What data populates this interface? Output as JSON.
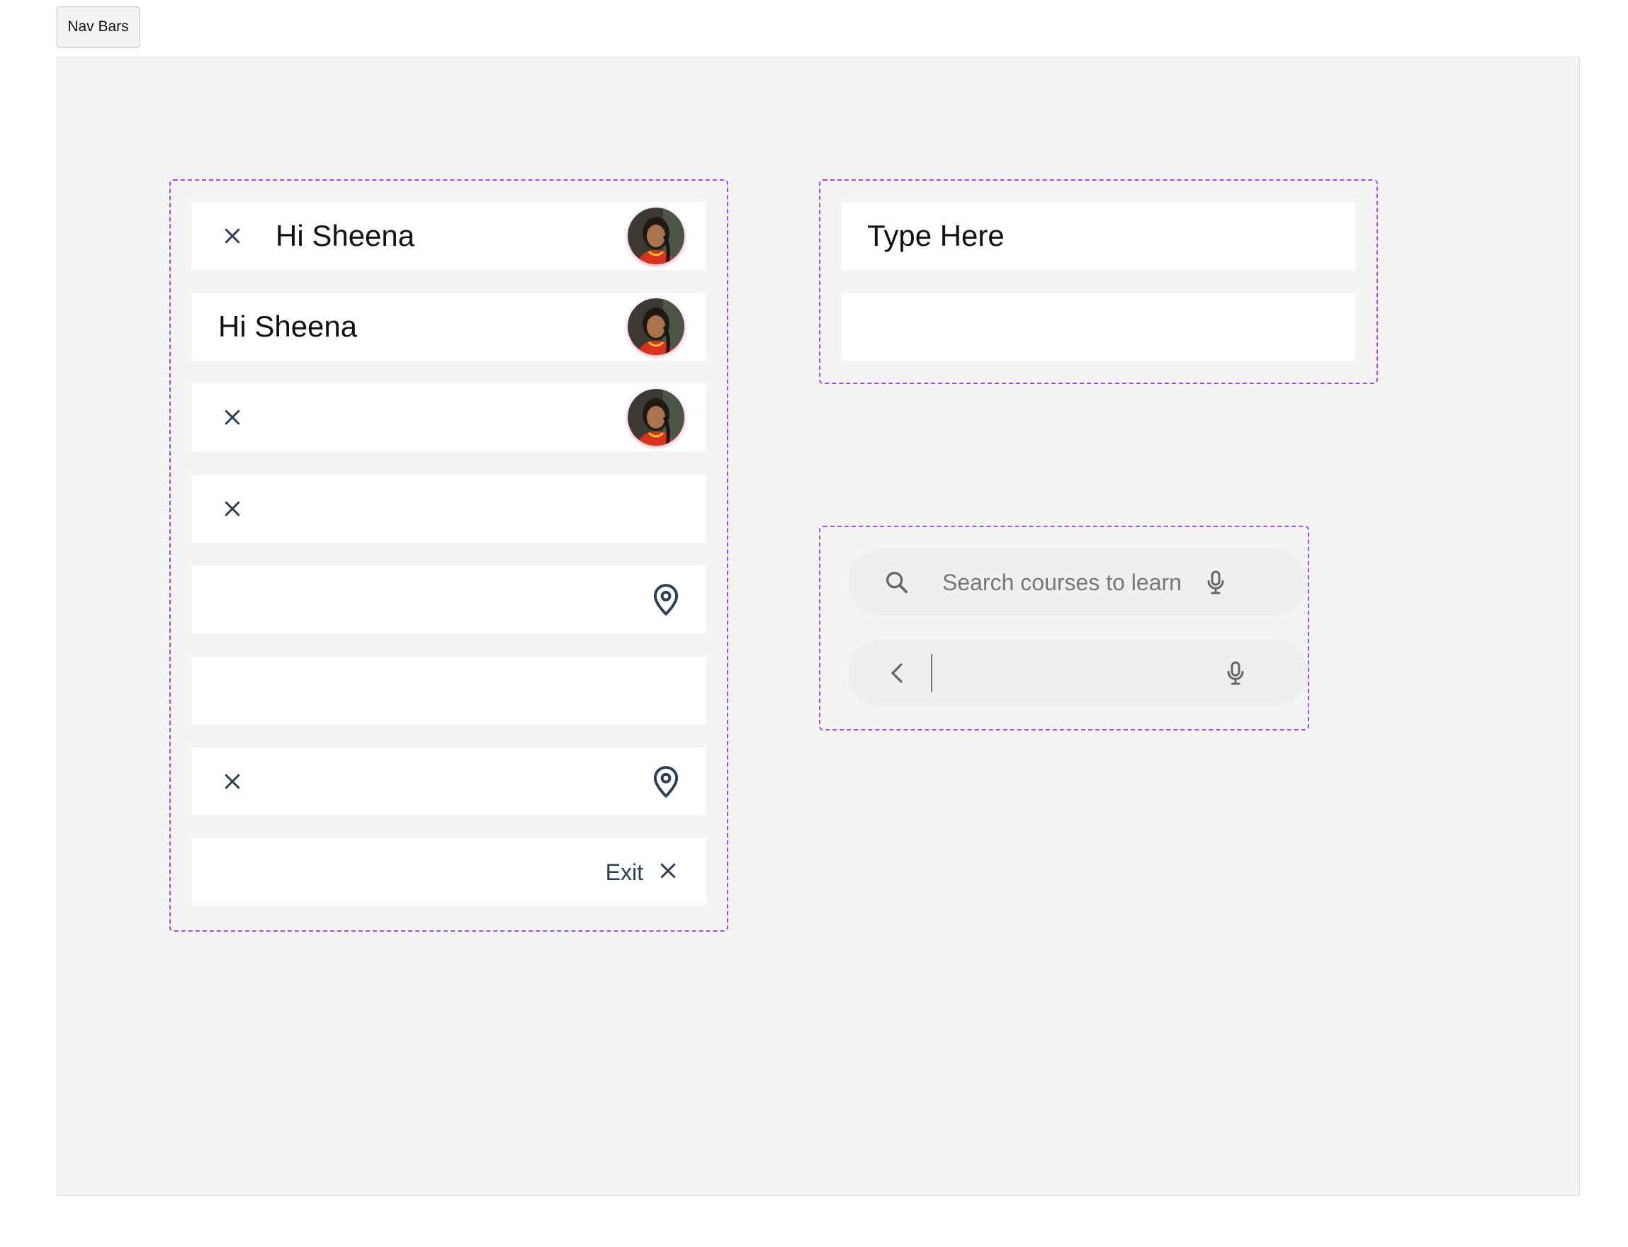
{
  "tab": {
    "label": "Nav Bars"
  },
  "left_bars": [
    {
      "title": "Hi Sheena"
    },
    {
      "title": "Hi Sheena"
    },
    {
      "title": ""
    },
    {
      "title": ""
    },
    {
      "title": ""
    },
    {
      "title": ""
    },
    {
      "title": ""
    },
    {
      "exit_label": "Exit"
    }
  ],
  "search_field": {
    "placeholder": "Type Here",
    "second_value": ""
  },
  "pill_search": {
    "placeholder": "Search courses to learn",
    "second_value": ""
  },
  "icons": {
    "close": "close-icon",
    "avatar": "avatar",
    "location": "location-pin-icon",
    "search": "search-icon",
    "mic": "mic-icon",
    "back": "chevron-left-icon"
  },
  "colors": {
    "dash_border": "#9b4dea",
    "icon_dark": "#2c3e50",
    "canvas_bg": "#f4f4f4"
  }
}
